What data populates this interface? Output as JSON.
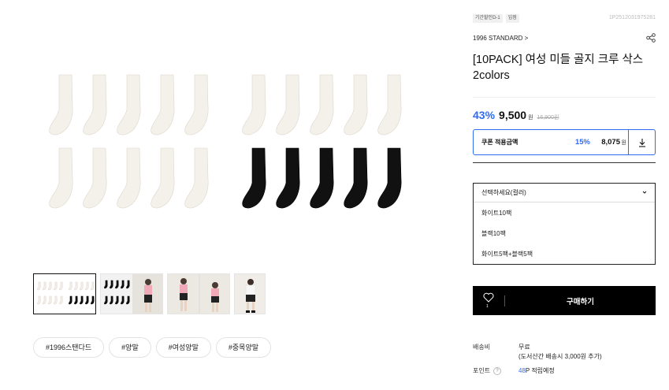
{
  "gallery": {
    "main_image": {
      "description": "white-and-black-socks-10pack",
      "colors": {
        "white_sock": "#f4f1ea",
        "black_sock": "#111111",
        "outline": "#dcd7cc"
      }
    },
    "thumbnails": [
      {
        "name": "thumb-socks-mixed",
        "active": true
      },
      {
        "name": "thumb-black-socks-model",
        "active": false
      },
      {
        "name": "thumb-model-pink",
        "active": false
      },
      {
        "name": "thumb-model-white",
        "active": false
      }
    ]
  },
  "hashtags": [
    "#1996스탠다드",
    "#양말",
    "#여성양말",
    "#중목양말"
  ],
  "product": {
    "badges": [
      "기간할인D-1",
      "입점"
    ],
    "code": "1P2512031975281",
    "brand": "1996 STANDARD >",
    "title": "[10PACK] 여성 미들 골지 크루 삭스 2colors",
    "discount": "43%",
    "price": "9,500",
    "won": "원",
    "original_price": "16,900원",
    "coupon": {
      "label": "쿠폰 적용금액",
      "rate": "15%",
      "price": "8,075",
      "won": "원"
    },
    "select": {
      "placeholder": "선택하세요(컬러)",
      "options": [
        "화이트10팩",
        "블랙10팩",
        "화이트5팩+블랙5팩"
      ]
    },
    "wish_count": "1",
    "buy_label": "구매하기",
    "shipping": {
      "label": "배송비",
      "value_line1": "무료",
      "value_line2": "(도서산간 배송시 3,000원 추가)"
    },
    "points": {
      "label": "포인트",
      "help": "?",
      "amount": "48",
      "suffix": "P 적립예정"
    }
  },
  "colors": {
    "accent": "#2e6cf6",
    "buy_bg": "#000000"
  }
}
